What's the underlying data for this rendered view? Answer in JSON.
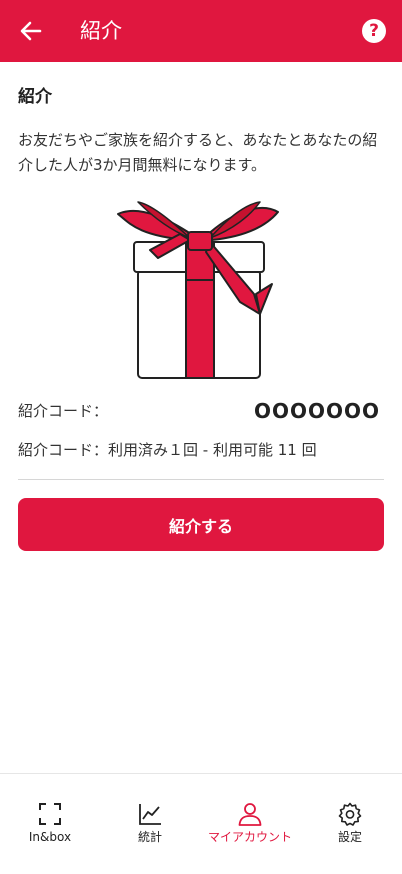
{
  "header": {
    "title": "紹介",
    "back_icon": "arrow-left-icon",
    "help_icon": "help-circle-icon",
    "help_glyph": "?"
  },
  "referral": {
    "heading": "紹介",
    "description": "お友だちやご家族を紹介すると、あなたとあなたの紹介した人が3か月間無料になります。",
    "code_label": "紹介コード：",
    "code_value": "OOOOOOO",
    "usage_text": "紹介コード：利用済み１回 - 利用可能 11 回",
    "button_label": "紹介する"
  },
  "bottom_nav": {
    "items": [
      {
        "label": "In&box",
        "icon": "scan-frame-icon",
        "active": false
      },
      {
        "label": "統計",
        "icon": "line-chart-icon",
        "active": false
      },
      {
        "label": "マイアカウント",
        "icon": "user-icon",
        "active": true
      },
      {
        "label": "設定",
        "icon": "gear-icon",
        "active": false
      }
    ]
  },
  "colors": {
    "accent": "#e0173f",
    "background": "#ffffff",
    "text": "#222222"
  }
}
